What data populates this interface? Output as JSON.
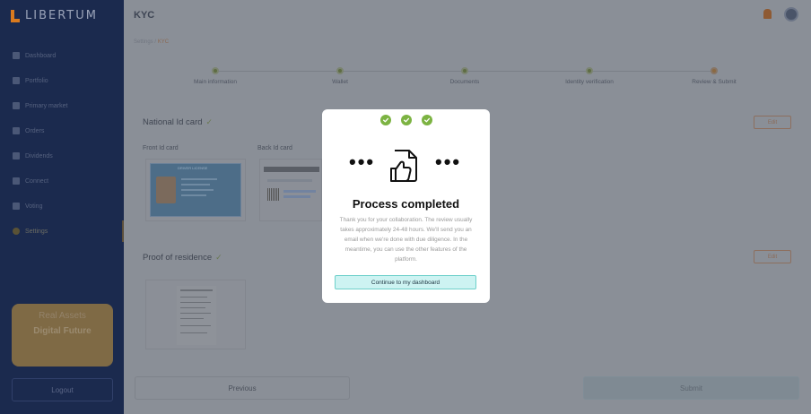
{
  "brand": {
    "name": "LIBERTUM"
  },
  "sidebar": {
    "items": [
      {
        "label": "Dashboard",
        "icon": "grid-icon"
      },
      {
        "label": "Portfolio",
        "icon": "pie-chart-icon"
      },
      {
        "label": "Primary market",
        "icon": "bar-chart-icon"
      },
      {
        "label": "Orders",
        "icon": "orders-icon"
      },
      {
        "label": "Dividends",
        "icon": "dividends-icon"
      },
      {
        "label": "Connect",
        "icon": "connect-icon"
      },
      {
        "label": "Voting",
        "icon": "voting-icon"
      },
      {
        "label": "Settings",
        "icon": "gear-icon",
        "active": true
      }
    ],
    "promo": {
      "line1": "Real Assets",
      "line2": "Digital Future"
    },
    "logout_label": "Logout"
  },
  "header": {
    "title": "KYC",
    "breadcrumb_root": "Settings",
    "breadcrumb_sep": " / ",
    "breadcrumb_current": "KYC"
  },
  "stepper": {
    "steps": [
      {
        "label": "Main information",
        "state": "done"
      },
      {
        "label": "Wallet",
        "state": "done"
      },
      {
        "label": "Documents",
        "state": "done"
      },
      {
        "label": "Identity verification",
        "state": "done"
      },
      {
        "label": "Review & Submit",
        "state": "current"
      }
    ]
  },
  "national_id": {
    "title": "National Id card",
    "edit_label": "Edit",
    "front_label": "Front Id card",
    "back_label": "Back Id card",
    "card_header": "DRIVER LICENSE"
  },
  "residence": {
    "title": "Proof of residence",
    "edit_label": "Edit"
  },
  "footer": {
    "previous_label": "Previous",
    "submit_label": "Submit"
  },
  "modal": {
    "title": "Process completed",
    "body": "Thank you for your collaboration. The review usually takes approximately 24-48 hours. We'll send you an email when we're done with due diligence. In the meantime, you can use the other features of the platform.",
    "button_label": "Continue to my dashboard",
    "ellipsis": "•••",
    "check_color": "#7cb342",
    "accent_color": "#6fd0cb"
  },
  "colors": {
    "sidebar_bg": "#1b2a4e",
    "brand_orange": "#d97a1e"
  }
}
